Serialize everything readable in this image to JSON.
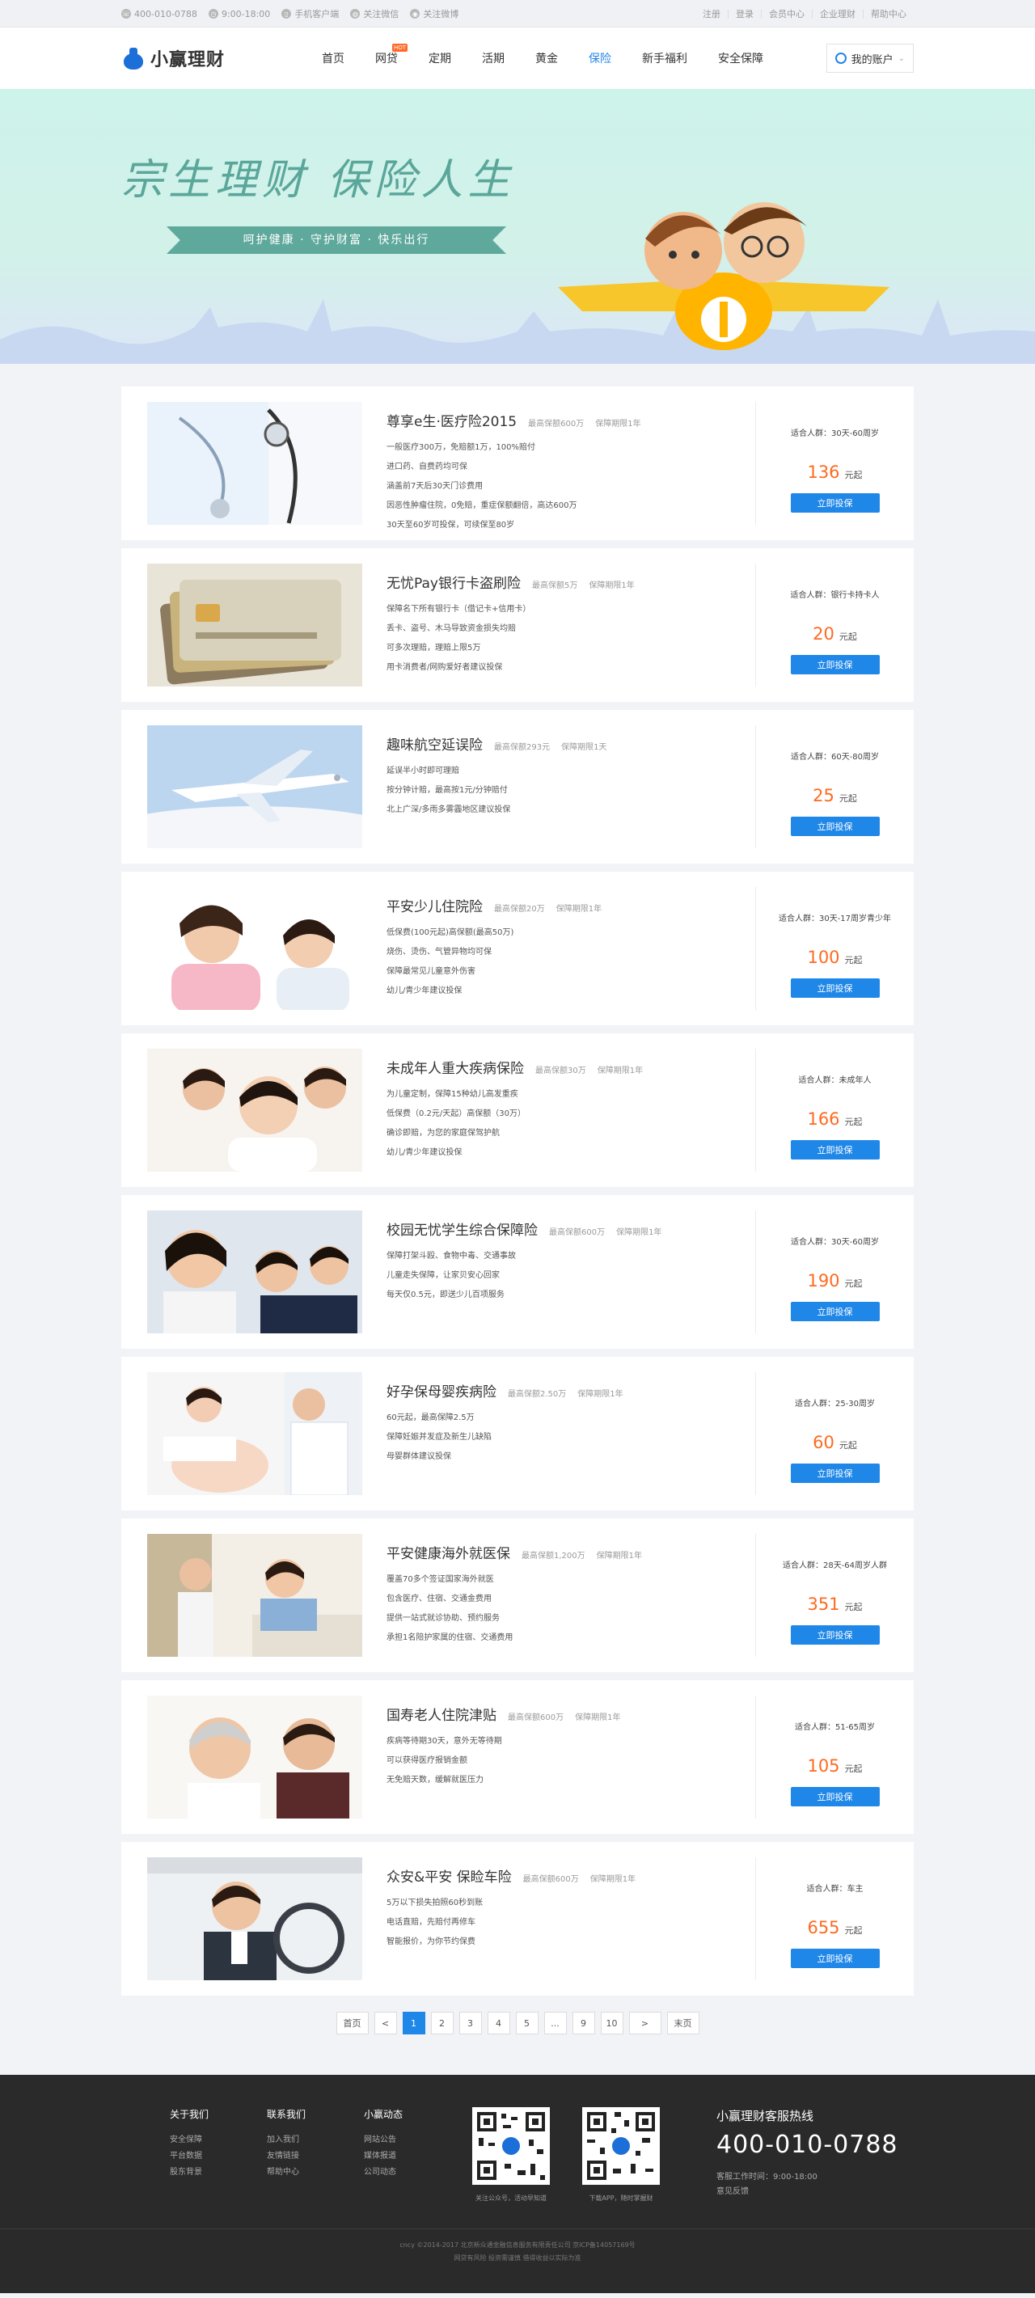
{
  "topbar": {
    "phone": "400-010-0788",
    "hours": "9:00-18:00",
    "mobile": "手机客户端",
    "wechat": "关注微信",
    "weibo": "关注微博",
    "links": [
      "注册",
      "登录",
      "会员中心",
      "企业理财",
      "帮助中心"
    ]
  },
  "header": {
    "logo": "小赢理财",
    "nav": [
      {
        "label": "首页",
        "active": false
      },
      {
        "label": "网贷",
        "active": false,
        "badge": "HOT"
      },
      {
        "label": "定期",
        "active": false
      },
      {
        "label": "活期",
        "active": false
      },
      {
        "label": "黄金",
        "active": false
      },
      {
        "label": "保险",
        "active": true
      },
      {
        "label": "新手福利",
        "active": false
      },
      {
        "label": "安全保障",
        "active": false
      }
    ],
    "account": "我的账户"
  },
  "banner": {
    "slogan": "宗生理财  保险人生",
    "ribbon": "呵护健康 · 守护财富 · 快乐出行"
  },
  "products": [
    {
      "title": "尊享e生·医疗险2015",
      "tags": [
        "最高保额600万",
        "保障期限1年"
      ],
      "bullets": [
        "一般医疗300万，免赔额1万，100%赔付",
        "进口药、自费药均可保",
        "涵盖前7天后30天门诊费用",
        "因恶性肿瘤住院，0免赔，重症保额翻倍，高达600万",
        "30天至60岁可投保，可续保至80岁"
      ],
      "audience": "适合人群：30天-60周岁",
      "price": "136",
      "unit": "元起",
      "button": "立即投保",
      "img": "doctor"
    },
    {
      "title": "无忧Pay银行卡盗刷险",
      "tags": [
        "最高保额5万",
        "保障期限1年"
      ],
      "bullets": [
        "保障名下所有银行卡（借记卡+信用卡）",
        "丢卡、盗号、木马导致资金损失均赔",
        "可多次理赔，理赔上限5万",
        "用卡消费者/网购爱好者建议投保"
      ],
      "audience": "适合人群：银行卡持卡人",
      "price": "20",
      "unit": "元起",
      "button": "立即投保",
      "img": "cards"
    },
    {
      "title": "趣味航空延误险",
      "tags": [
        "最高保额293元",
        "保障期限1天"
      ],
      "bullets": [
        "延误半小时即可理赔",
        "按分钟计赔，最高按1元/分钟赔付",
        "北上广深/多雨多雾霾地区建议投保"
      ],
      "audience": "适合人群：60天-80周岁",
      "price": "25",
      "unit": "元起",
      "button": "立即投保",
      "img": "plane"
    },
    {
      "title": "平安少儿住院险",
      "tags": [
        "最高保额20万",
        "保障期限1年"
      ],
      "bullets": [
        "低保费(100元起)高保额(最高50万)",
        "烧伤、烫伤、气管异物均可保",
        "保障最常见儿童意外伤害",
        "幼儿/青少年建议投保"
      ],
      "audience": "适合人群：30天-17周岁青少年",
      "price": "100",
      "unit": "元起",
      "button": "立即投保",
      "img": "nurse"
    },
    {
      "title": "未成年人重大疾病保险",
      "tags": [
        "最高保额30万",
        "保障期限1年"
      ],
      "bullets": [
        "为儿童定制，保障15种幼儿高发重疾",
        "低保费（0.2元/天起）高保额（30万）",
        "确诊即赔，为您的家庭保驾护航",
        "幼儿/青少年建议投保"
      ],
      "audience": "适合人群：未成年人",
      "price": "166",
      "unit": "元起",
      "button": "立即投保",
      "img": "family"
    },
    {
      "title": "校园无忧学生综合保障险",
      "tags": [
        "最高保额600万",
        "保障期限1年"
      ],
      "bullets": [
        "保障打架斗殴、食物中毒、交通事故",
        "儿童走失保障，让家贝安心回家",
        "每天仅0.5元，即送少儿百项服务"
      ],
      "audience": "适合人群：30天-60周岁",
      "price": "190",
      "unit": "元起",
      "button": "立即投保",
      "img": "students"
    },
    {
      "title": "好孕保母婴疾病险",
      "tags": [
        "最高保额2.50万",
        "保障期限1年"
      ],
      "bullets": [
        "60元起，最高保障2.5万",
        "保障妊娠并发症及新生儿缺陷",
        "母婴群体建议投保"
      ],
      "audience": "适合人群：25-30周岁",
      "price": "60",
      "unit": "元起",
      "button": "立即投保",
      "img": "pregnant"
    },
    {
      "title": "平安健康海外就医保",
      "tags": [
        "最高保额1,200万",
        "保障期限1年"
      ],
      "bullets": [
        "覆盖70多个签证国家海外就医",
        "包含医疗、住宿、交通金费用",
        "提供一站式就诊协助、预约服务",
        "承担1名陪护家属的住宿、交通费用"
      ],
      "audience": "适合人群：28天-64周岁人群",
      "price": "351",
      "unit": "元起",
      "button": "立即投保",
      "img": "hospital"
    },
    {
      "title": "国寿老人住院津贴",
      "tags": [
        "最高保额600万",
        "保障期限1年"
      ],
      "bullets": [
        "疾病等待期30天，意外无等待期",
        "可以获得医疗报销金额",
        "无免赔天数，缓解就医压力"
      ],
      "audience": "适合人群：51-65周岁",
      "price": "105",
      "unit": "元起",
      "button": "立即投保",
      "img": "elderly"
    },
    {
      "title": "众安&平安 保睑车险",
      "tags": [
        "最高保额600万",
        "保障期限1年"
      ],
      "bullets": [
        "5万以下损失拍照60秒到账",
        "电话直赔，先赔付再修车",
        "智能报价，为你节约保费"
      ],
      "audience": "适合人群：车主",
      "price": "655",
      "unit": "元起",
      "button": "立即投保",
      "img": "driver"
    }
  ],
  "pagination": {
    "first": "首页",
    "prev": "<",
    "pages": [
      "1",
      "2",
      "3",
      "4",
      "5",
      "...",
      "9",
      "10"
    ],
    "current": "1",
    "next": ">",
    "last": "末页"
  },
  "footer": {
    "cols": [
      {
        "title": "关于我们",
        "items": [
          "安全保障",
          "平台数据",
          "股东背景"
        ]
      },
      {
        "title": "联系我们",
        "items": [
          "加入我们",
          "友情链接",
          "帮助中心"
        ]
      },
      {
        "title": "小赢动态",
        "items": [
          "网站公告",
          "媒体报道",
          "公司动态"
        ]
      }
    ],
    "qr": [
      {
        "caption": "关注公众号，活动早知道"
      },
      {
        "caption": "下载APP，随时掌握财"
      }
    ],
    "hotline_title": "小赢理财客服热线",
    "hotline_number": "400-010-0788",
    "hotline_hours": "客服工作时间：9:00-18:00",
    "feedback": "意见反馈",
    "copyright": "cncy ©2014-2017 北京新众通金融信息服务有限责任公司 京ICP备14057169号",
    "risk": "网贷有风险 投资需谨慎 借得收益以实际为准"
  }
}
